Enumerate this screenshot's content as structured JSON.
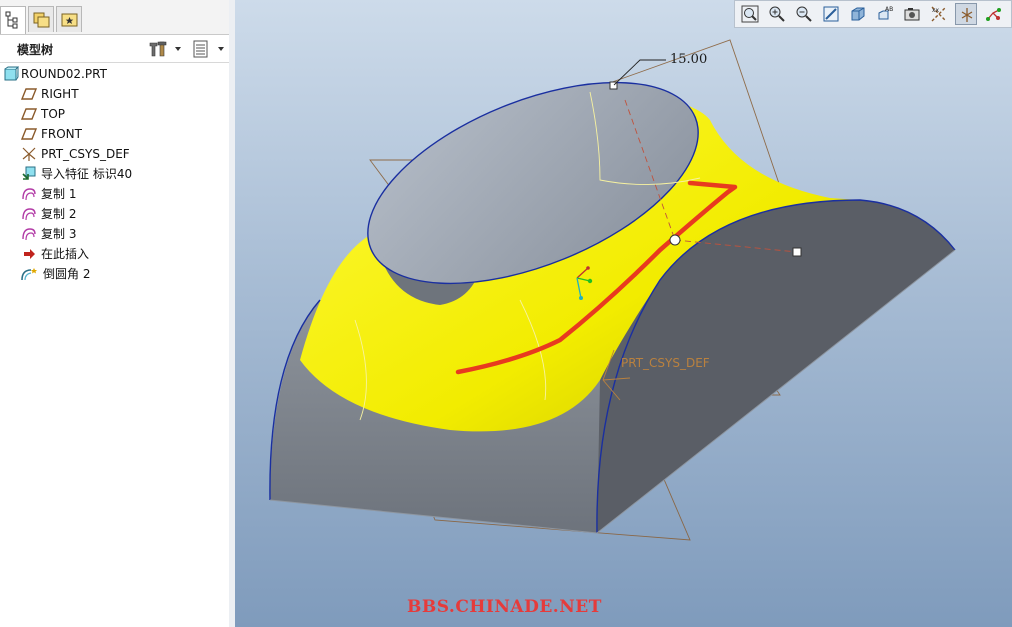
{
  "panel": {
    "tabs": [
      {
        "name": "model-tree-tab-icon"
      },
      {
        "name": "folder-browser-tab-icon"
      },
      {
        "name": "favorites-tab-icon"
      }
    ],
    "tree_title": "模型树"
  },
  "tree": {
    "items": [
      {
        "label": "ROUND02.PRT",
        "icon": "part-icon"
      },
      {
        "label": "RIGHT",
        "icon": "datum-plane-icon"
      },
      {
        "label": "TOP",
        "icon": "datum-plane-icon"
      },
      {
        "label": "FRONT",
        "icon": "datum-plane-icon"
      },
      {
        "label": "PRT_CSYS_DEF",
        "icon": "csys-icon"
      },
      {
        "label": "导入特征 标识40",
        "icon": "import-feature-icon"
      },
      {
        "label": "复制 1",
        "icon": "copy-surface-icon"
      },
      {
        "label": "复制 2",
        "icon": "copy-surface-icon"
      },
      {
        "label": "复制 3",
        "icon": "copy-surface-icon"
      },
      {
        "label": "在此插入",
        "icon": "insert-here-arrow-icon"
      },
      {
        "label": "倒圆角 2",
        "icon": "round-feature-icon"
      }
    ]
  },
  "toolbar": {
    "buttons": [
      "zoom-fit-icon",
      "zoom-in-icon",
      "zoom-out-icon",
      "repaint-icon",
      "shading-icon",
      "named-views-icon",
      "saved-views-icon",
      "datum-axes-toggle-icon",
      "datum-planes-toggle-icon",
      "csys-toggle-icon"
    ]
  },
  "viewport": {
    "dimension_value": "15.00",
    "csys_label": "PRT_CSYS_DEF",
    "watermark": "BBS.CHINADE.NET"
  },
  "colors": {
    "surface_yellow": "#f5f000",
    "solid_gray": "#5f636b",
    "top_gray": "#9aa3b0",
    "edge_blue": "#1a2fa0",
    "highlight_red": "#e83a1f"
  }
}
